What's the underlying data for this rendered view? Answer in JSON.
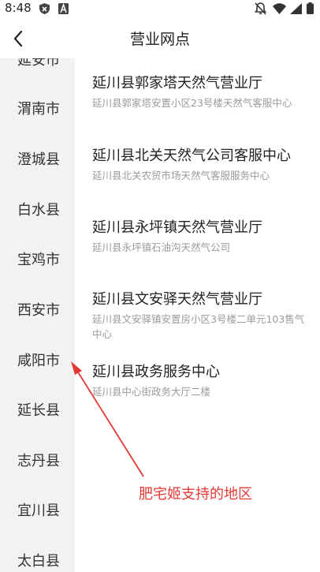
{
  "status_bar": {
    "time": "8:48",
    "icons": [
      "shield-icon",
      "font-a-icon",
      "mute-bell-icon",
      "wifi-icon",
      "signal-icon",
      "battery-icon"
    ]
  },
  "header": {
    "back_icon": "chevron-left-icon",
    "title": "营业网点"
  },
  "sidebar": {
    "items": [
      "延安市",
      "渭南市",
      "澄城县",
      "白水县",
      "宝鸡市",
      "西安市",
      "咸阳市",
      "延长县",
      "志丹县",
      "宜川县",
      "太白县"
    ]
  },
  "stations": [
    {
      "name": "延川县郭家塔天然气营业厅",
      "address": "延川县郭家塔安置小区23号楼天然气客服中心"
    },
    {
      "name": "延川县北关天然气公司客服中心",
      "address": "延川县北关农贸市场天然气客服服务中心"
    },
    {
      "name": "延川县永坪镇天然气营业厅",
      "address": "延川县永坪镇石油沟天然气公司"
    },
    {
      "name": "延川县文安驿天然气营业厅",
      "address": "延川县文安驿镇安置房小区3号楼二单元103售气中心"
    },
    {
      "name": "延川县政务服务中心",
      "address": "延川县中心街政务大厅二楼"
    }
  ],
  "annotation": {
    "text": "肥宅姬支持的地区",
    "color": "#e53935"
  }
}
